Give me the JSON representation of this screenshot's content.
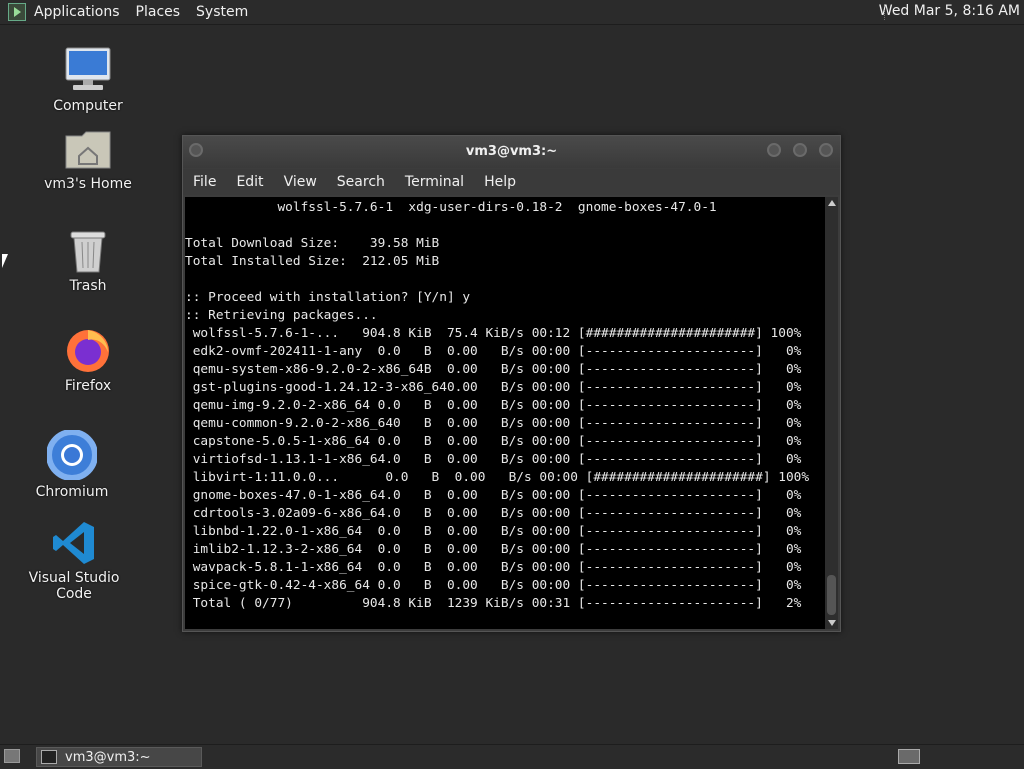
{
  "top_panel": {
    "menus": [
      "Applications",
      "Places",
      "System"
    ],
    "clock": "Wed Mar 5,  8:16 AM"
  },
  "desktop": {
    "icons": [
      {
        "label": "Computer",
        "icon": "computer-icon"
      },
      {
        "label": "vm3's Home",
        "icon": "home-folder-icon"
      },
      {
        "label": "Trash",
        "icon": "trash-icon"
      },
      {
        "label": "Firefox",
        "icon": "firefox-icon"
      },
      {
        "label": "Chromium",
        "icon": "chromium-icon"
      },
      {
        "label": "Visual Studio Code",
        "icon": "vscode-icon"
      }
    ]
  },
  "terminal": {
    "title": "vm3@vm3:~",
    "menus": [
      "File",
      "Edit",
      "View",
      "Search",
      "Terminal",
      "Help"
    ],
    "lines": [
      "            wolfssl-5.7.6-1  xdg-user-dirs-0.18-2  gnome-boxes-47.0-1",
      "",
      "Total Download Size:    39.58 MiB",
      "Total Installed Size:  212.05 MiB",
      "",
      ":: Proceed with installation? [Y/n] y",
      ":: Retrieving packages...",
      " wolfssl-5.7.6-1-...   904.8 KiB  75.4 KiB/s 00:12 [######################] 100%",
      " edk2-ovmf-202411-1-any  0.0   B  0.00   B/s 00:00 [----------------------]   0%",
      " qemu-system-x86-9.2.0-2-x86_64B  0.00   B/s 00:00 [----------------------]   0%",
      " gst-plugins-good-1.24.12-3-x86_640.00   B/s 00:00 [----------------------]   0%",
      " qemu-img-9.2.0-2-x86_64 0.0   B  0.00   B/s 00:00 [----------------------]   0%",
      " qemu-common-9.2.0-2-x86_640   B  0.00   B/s 00:00 [----------------------]   0%",
      " capstone-5.0.5-1-x86_64 0.0   B  0.00   B/s 00:00 [----------------------]   0%",
      " virtiofsd-1.13.1-1-x86_64.0   B  0.00   B/s 00:00 [----------------------]   0%",
      " libvirt-1:11.0.0...      0.0   B  0.00   B/s 00:00 [######################] 100%",
      " gnome-boxes-47.0-1-x86_64.0   B  0.00   B/s 00:00 [----------------------]   0%",
      " cdrtools-3.02a09-6-x86_64.0   B  0.00   B/s 00:00 [----------------------]   0%",
      " libnbd-1.22.0-1-x86_64  0.0   B  0.00   B/s 00:00 [----------------------]   0%",
      " imlib2-1.12.3-2-x86_64  0.0   B  0.00   B/s 00:00 [----------------------]   0%",
      " wavpack-5.8.1-1-x86_64  0.0   B  0.00   B/s 00:00 [----------------------]   0%",
      " spice-gtk-0.42-4-x86_64 0.0   B  0.00   B/s 00:00 [----------------------]   0%",
      " Total ( 0/77)         904.8 KiB  1239 KiB/s 00:31 [----------------------]   2%"
    ]
  },
  "taskbar": {
    "tasks": [
      {
        "label": "vm3@vm3:~",
        "icon": "terminal-icon"
      }
    ]
  },
  "colors": {
    "desktop_bg": "#2a2a2a",
    "panel_bg": "#2b2b2b",
    "terminal_bg": "#000000",
    "terminal_fg": "#e8e8e8"
  }
}
